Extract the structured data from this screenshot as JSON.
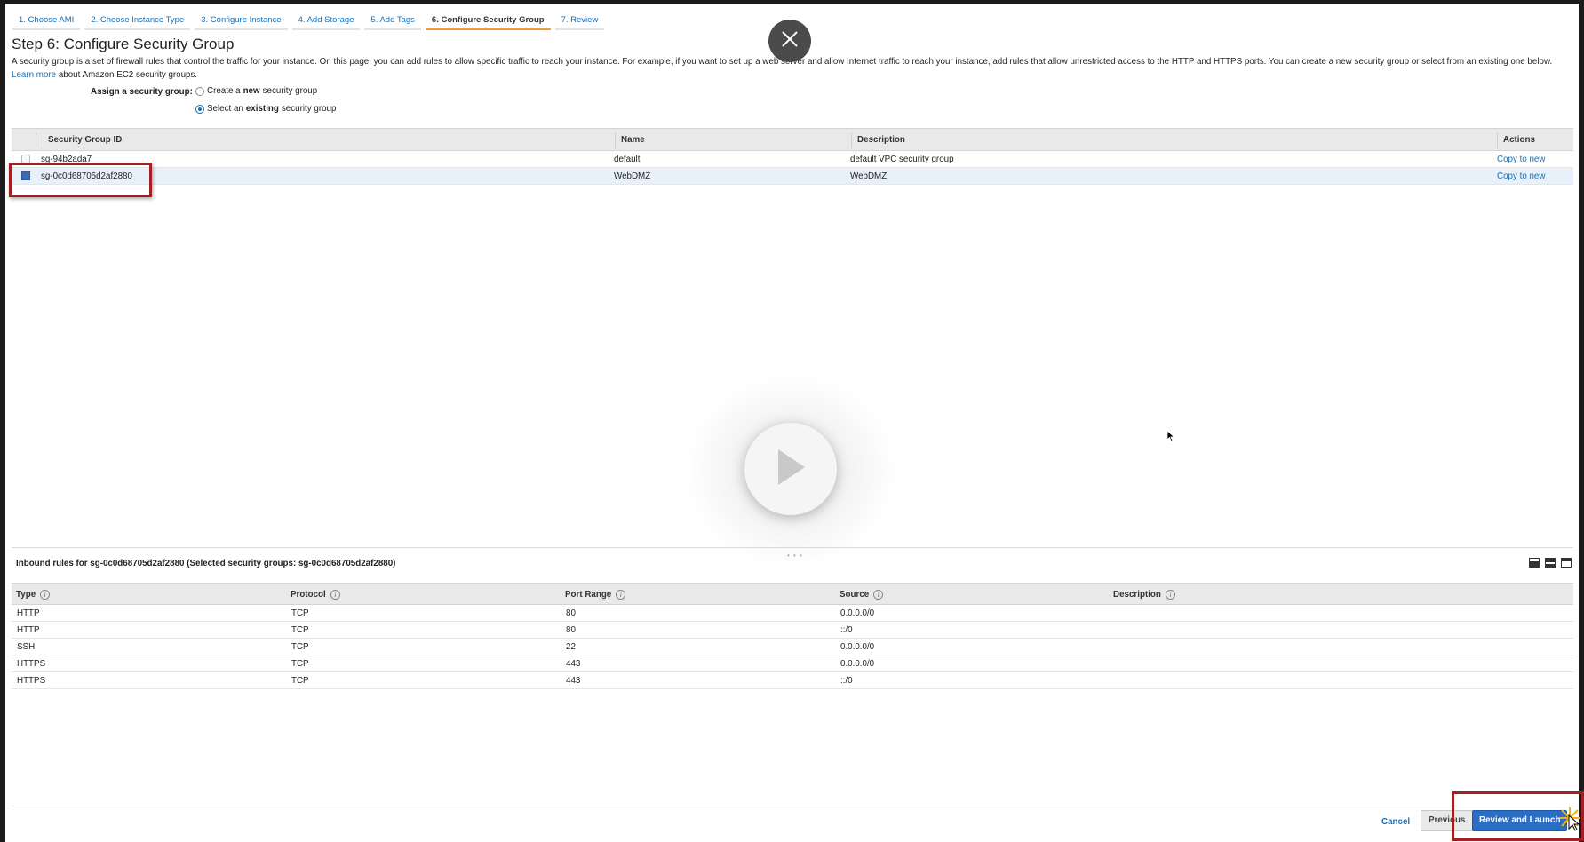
{
  "wizard": {
    "steps": [
      {
        "label": "1. Choose AMI"
      },
      {
        "label": "2. Choose Instance Type"
      },
      {
        "label": "3. Configure Instance"
      },
      {
        "label": "4. Add Storage"
      },
      {
        "label": "5. Add Tags"
      },
      {
        "label": "6. Configure Security Group",
        "active": true
      },
      {
        "label": "7. Review"
      }
    ]
  },
  "page": {
    "title": "Step 6: Configure Security Group",
    "description": "A security group is a set of firewall rules that control the traffic for your instance. On this page, you can add rules to allow specific traffic to reach your instance. For example, if you want to set up a web server and allow Internet traffic to reach your instance, add rules that allow unrestricted access to the HTTP and HTTPS ports. You can create a new security group or select from an existing one below.",
    "learn_more": "Learn more",
    "learn_more_suffix": " about Amazon EC2 security groups."
  },
  "assign": {
    "label": "Assign a security group:",
    "option_new_prefix": "Create a ",
    "option_new_bold": "new",
    "option_new_suffix": " security group",
    "option_existing_prefix": "Select an ",
    "option_existing_bold": "existing",
    "option_existing_suffix": " security group",
    "selected": "existing"
  },
  "sg_table": {
    "headers": {
      "id": "Security Group ID",
      "name": "Name",
      "description": "Description",
      "actions": "Actions"
    },
    "rows": [
      {
        "id": "sg-94b2ada7",
        "name": "default",
        "description": "default VPC security group",
        "action": "Copy to new",
        "selected": false
      },
      {
        "id": "sg-0c0d68705d2af2880",
        "name": "WebDMZ",
        "description": "WebDMZ",
        "action": "Copy to new",
        "selected": true
      }
    ]
  },
  "inbound": {
    "title": "Inbound rules for sg-0c0d68705d2af2880 (Selected security groups: sg-0c0d68705d2af2880)",
    "headers": {
      "type": "Type",
      "protocol": "Protocol",
      "port_range": "Port Range",
      "source": "Source",
      "description": "Description"
    },
    "rows": [
      {
        "type": "HTTP",
        "protocol": "TCP",
        "port_range": "80",
        "source": "0.0.0.0/0",
        "description": ""
      },
      {
        "type": "HTTP",
        "protocol": "TCP",
        "port_range": "80",
        "source": "::/0",
        "description": ""
      },
      {
        "type": "SSH",
        "protocol": "TCP",
        "port_range": "22",
        "source": "0.0.0.0/0",
        "description": ""
      },
      {
        "type": "HTTPS",
        "protocol": "TCP",
        "port_range": "443",
        "source": "0.0.0.0/0",
        "description": ""
      },
      {
        "type": "HTTPS",
        "protocol": "TCP",
        "port_range": "443",
        "source": "::/0",
        "description": ""
      }
    ]
  },
  "footer": {
    "cancel": "Cancel",
    "previous": "Previous",
    "review_launch": "Review and Launch"
  },
  "icons": {
    "close": "close-icon",
    "play": "play-icon",
    "info": "info-icon",
    "cursor": "mouse-cursor-icon"
  },
  "colors": {
    "accent_link": "#1a6fb3",
    "active_tab": "#f29e38",
    "primary_button": "#2a6dc4",
    "highlight_box": "#a41f24"
  }
}
